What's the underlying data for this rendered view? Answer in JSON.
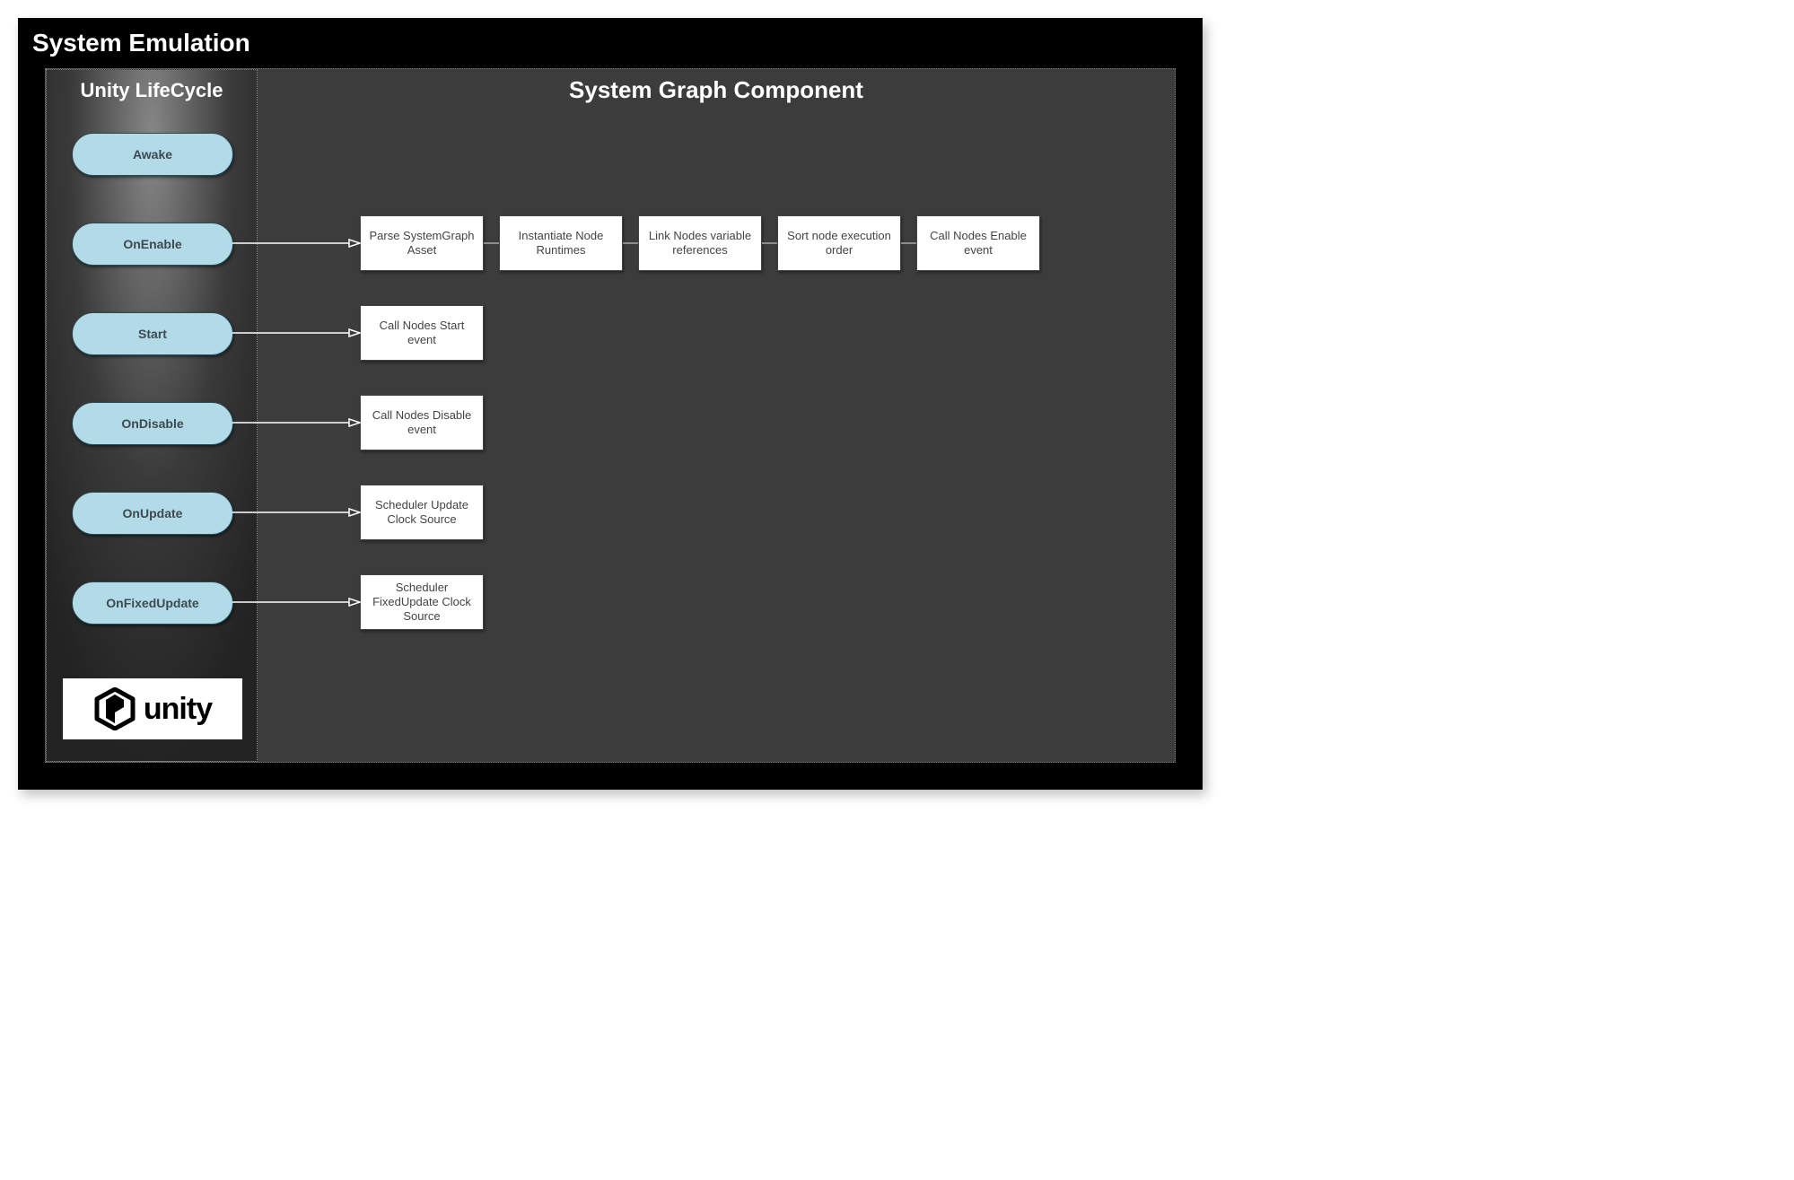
{
  "title": "System Emulation",
  "lifecycle": {
    "title": "Unity LifeCycle",
    "items": [
      "Awake",
      "OnEnable",
      "Start",
      "OnDisable",
      "OnUpdate",
      "OnFixedUpdate"
    ],
    "logo_text": "unity"
  },
  "component": {
    "title": "System Graph Component",
    "rows": {
      "onEnable": [
        "Parse SystemGraph Asset",
        "Instantiate Node Runtimes",
        "Link Nodes variable references",
        "Sort node execution order",
        "Call Nodes Enable event"
      ],
      "start": [
        "Call Nodes Start event"
      ],
      "onDisable": [
        "Call Nodes Disable event"
      ],
      "onUpdate": [
        "Scheduler Update Clock Source"
      ],
      "onFixedUpdate": [
        "Scheduler FixedUpdate Clock Source"
      ]
    }
  }
}
